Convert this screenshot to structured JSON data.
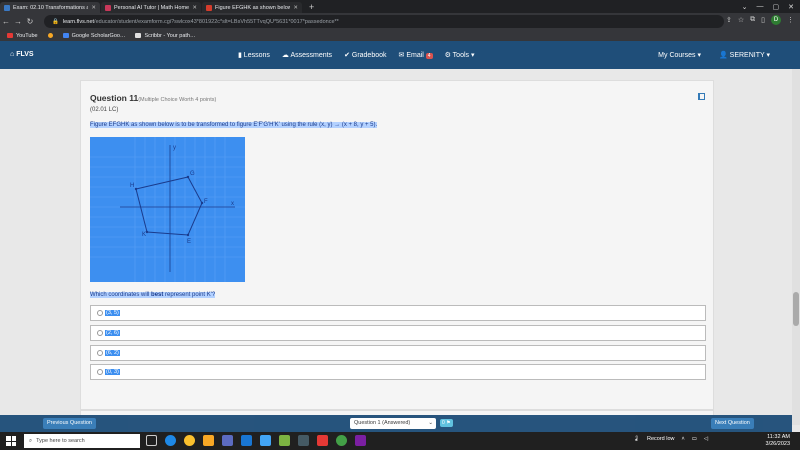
{
  "browser": {
    "tabs": [
      {
        "label": "Exam: 02.10 Transformations and…",
        "color": "#3a79c4",
        "active": true
      },
      {
        "label": "Personal AI Tutor | Math Homew…",
        "color": "#c8385a",
        "active": false
      },
      {
        "label": "Figure EFGHK as shown below is…",
        "color": "#d43c2c",
        "active": false
      }
    ],
    "new_tab": "+",
    "url_host": "learn.flvs.net",
    "url_path": "/educator/student/examform.cgi?swlcox43*801922c*slt=LBsVh55TTvqQU*5631*0017*passedonce**",
    "profile_initial": "D",
    "bookmarks": [
      {
        "label": "YouTube",
        "color": "#e53935"
      },
      {
        "label": "",
        "color": "#f9a825"
      },
      {
        "label": "Google ScholarGoo…",
        "color": "#4285f4"
      },
      {
        "label": "Scribbr - Your path…",
        "color": "#e0e0e0"
      }
    ]
  },
  "site_nav": {
    "brand": "FLVS",
    "items": [
      "Lessons",
      "Assessments",
      "Gradebook",
      "Email",
      "Tools ▾"
    ],
    "email_badge": "4",
    "right": [
      "My Courses ▾",
      "SERENITY ▾"
    ]
  },
  "question": {
    "title": "Question 11",
    "worth": "(Multiple Choice Worth 4 points)",
    "sub": "(02.01 LC)",
    "text": "Figure EFGHK as shown below is to be transformed to figure E'F'G'H'K' using the rule (x, y) → (x + 8, y + 5).",
    "prompt_pre": "Which coordinates will ",
    "prompt_bold": "best",
    "prompt_post": " represent point K'?",
    "choices": [
      "(3, 5)",
      "(2, 6)",
      "(6, 2)",
      "(0, 3)"
    ],
    "graph_labels": {
      "y": "y",
      "x": "x",
      "G": "G",
      "H": "H",
      "F": "F",
      "K": "K",
      "E": "E"
    }
  },
  "footer": {
    "prev": "Previous Question",
    "select": "Question 1 (Answered)",
    "flag_count": "0",
    "next": "Next Question"
  },
  "taskbar": {
    "search": "Type here to search",
    "tray": "Record low",
    "time": "11:32 AM",
    "date": "3/26/2023"
  }
}
